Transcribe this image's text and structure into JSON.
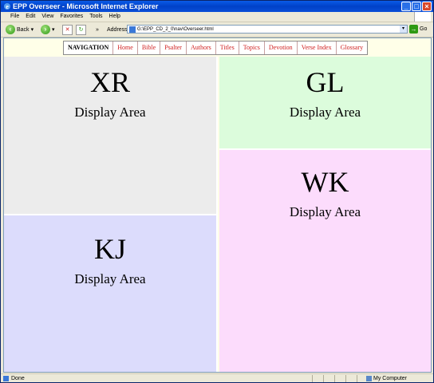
{
  "window": {
    "title": "EPP Overseer - Microsoft Internet Explorer"
  },
  "menubar": {
    "items": [
      "File",
      "Edit",
      "View",
      "Favorites",
      "Tools",
      "Help"
    ]
  },
  "toolbar": {
    "back_label": "Back",
    "address_label": "Address",
    "address_value": "G:\\EPP_CD_2_0\\nav\\Overseer.html",
    "go_label": "Go"
  },
  "nav": {
    "label": "NAVIGATION",
    "links": [
      "Home",
      "Bible",
      "Psalter",
      "Authors",
      "Titles",
      "Topics",
      "Devotion",
      "Verse Index",
      "Glossary"
    ]
  },
  "frames": {
    "xr": {
      "code": "XR",
      "label": "Display Area",
      "color": "#ececec"
    },
    "gl": {
      "code": "GL",
      "label": "Display Area",
      "color": "#dcfcdc"
    },
    "kj": {
      "code": "KJ",
      "label": "Display Area",
      "color": "#dcdcfc"
    },
    "wk": {
      "code": "WK",
      "label": "Display Area",
      "color": "#fcdcfc"
    }
  },
  "statusbar": {
    "status": "Done",
    "zone": "My Computer"
  },
  "colors": {
    "link": "#d02020",
    "title_bar": "#0041c8"
  }
}
